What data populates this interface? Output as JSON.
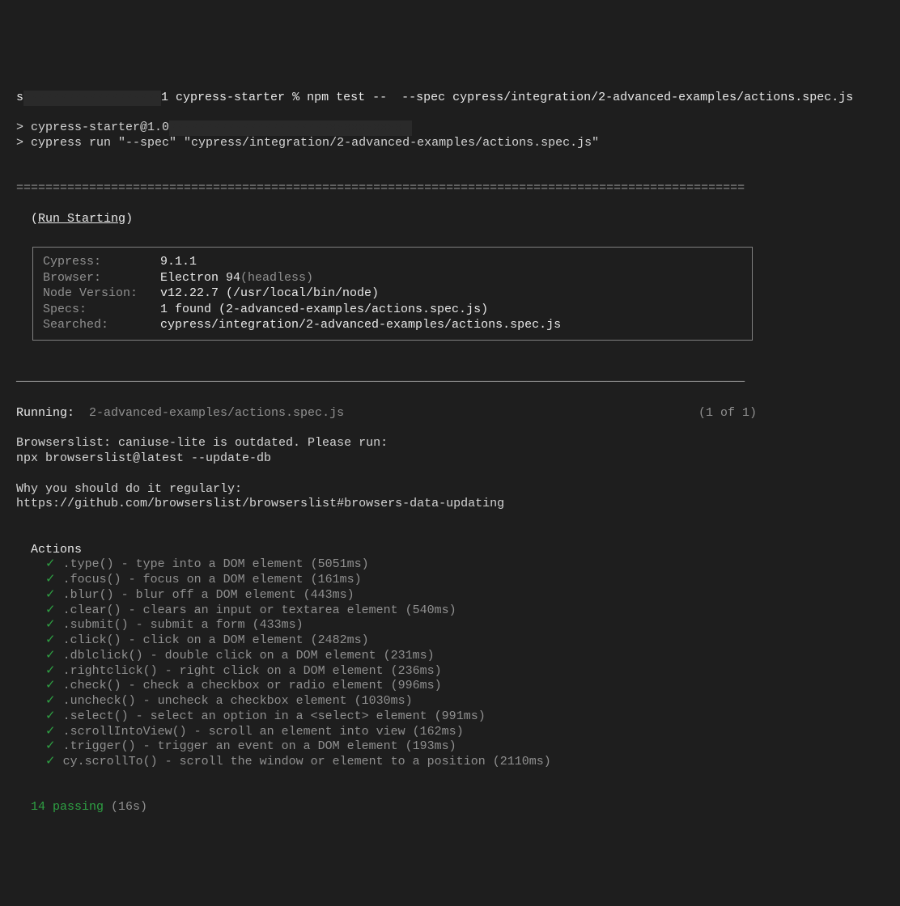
{
  "prompt": {
    "user_host": "s",
    "redacted_segment": "xxxxxxxxxxxxxxxxxxx",
    "dir": "1 cypress-starter",
    "sep": "%",
    "command": "npm test --  --spec cypress/integration/2-advanced-examples/actions.spec.js"
  },
  "npm_output": {
    "line1": "> cypress-starter@1.0",
    "redacted_segment": "xxxxxxxxxxxxxxxxxxxxxxxxxxxxxxxx",
    "line2": "> cypress run \"--spec\" \"cypress/integration/2-advanced-examples/actions.spec.js\""
  },
  "divider_top": "====================================================================================================",
  "run_starting": {
    "open": "(",
    "label": "Run Starting",
    "close": ")"
  },
  "info_box": {
    "rows": [
      {
        "label": "Cypress:",
        "value": "9.1.1",
        "extra": ""
      },
      {
        "label": "Browser:",
        "value": "Electron 94",
        "extra": "(headless)"
      },
      {
        "label": "Node Version:",
        "value": "v12.22.7 (/usr/local/bin/node)",
        "extra": ""
      },
      {
        "label": "Specs:",
        "value": "1 found (2-advanced-examples/actions.spec.js)",
        "extra": ""
      },
      {
        "label": "Searched:",
        "value": "cypress/integration/2-advanced-examples/actions.spec.js",
        "extra": ""
      }
    ]
  },
  "divider_mid": "────────────────────────────────────────────────────────────────────────────────────────────────────",
  "running": {
    "label": "Running:",
    "file": "2-advanced-examples/actions.spec.js",
    "count": "(1 of 1)"
  },
  "browserslist": {
    "l1": "Browserslist: caniuse-lite is outdated. Please run:",
    "l2": "npx browserslist@latest --update-db",
    "l3": "Why you should do it regularly:",
    "l4": "https://github.com/browserslist/browserslist#browsers-data-updating"
  },
  "suite_name": "Actions",
  "tests": [
    ".type() - type into a DOM element (5051ms)",
    ".focus() - focus on a DOM element (161ms)",
    ".blur() - blur off a DOM element (443ms)",
    ".clear() - clears an input or textarea element (540ms)",
    ".submit() - submit a form (433ms)",
    ".click() - click on a DOM element (2482ms)",
    ".dblclick() - double click on a DOM element (231ms)",
    ".rightclick() - right click on a DOM element (236ms)",
    ".check() - check a checkbox or radio element (996ms)",
    ".uncheck() - uncheck a checkbox element (1030ms)",
    ".select() - select an option in a <select> element (991ms)",
    ".scrollIntoView() - scroll an element into view (162ms)",
    ".trigger() - trigger an event on a DOM element (193ms)",
    "cy.scrollTo() - scroll the window or element to a position (2110ms)"
  ],
  "summary": {
    "passing": "14 passing",
    "time": "(16s)"
  }
}
